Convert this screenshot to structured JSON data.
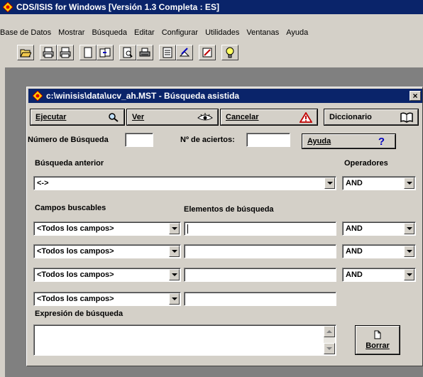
{
  "app": {
    "title": "CDS/ISIS for Windows [Versión 1.3 Completa : ES]"
  },
  "menu": [
    "Base de Datos",
    "Mostrar",
    "Búsqueda",
    "Editar",
    "Configurar",
    "Utilidades",
    "Ventanas",
    "Ayuda"
  ],
  "toolbar": {
    "icons": [
      "open-folder-icon",
      "print-txt-icon",
      "print-rtf-icon",
      "document-icon",
      "copy-doc-icon",
      "preview-icon",
      "printer-icon",
      "form-icon",
      "edit-form-icon",
      "pencil-icon",
      "lightbulb-icon"
    ]
  },
  "dialog": {
    "title": "c:\\winisis\\data\\ucv_ah.MST - Búsqueda asistida",
    "close": "×",
    "buttons": {
      "ejecutar": "Ejecutar",
      "ver": "Ver",
      "cancelar": "Cancelar",
      "diccionario": "Diccionario",
      "ayuda": "Ayuda",
      "ayuda_icon": "?",
      "borrar": "Borrar"
    },
    "labels": {
      "numero_busqueda": "Número de Búsqueda",
      "n_aciertos": "Nº de aciertos:",
      "busqueda_anterior": "Búsqueda anterior",
      "operadores": "Operadores",
      "campos_buscables": "Campos buscables",
      "elementos_busqueda": "Elementos de búsqueda",
      "expresion_busqueda": "Expresión de búsqueda"
    },
    "fields": {
      "numero_busqueda": "",
      "n_aciertos": "",
      "busqueda_anterior": "<->",
      "operador_anterior": "AND"
    },
    "rows": [
      {
        "campo": "<Todos los campos>",
        "elemento": "",
        "operador": "AND"
      },
      {
        "campo": "<Todos los campos>",
        "elemento": "",
        "operador": "AND"
      },
      {
        "campo": "<Todos los campos>",
        "elemento": "",
        "operador": "AND"
      },
      {
        "campo": "<Todos los campos>",
        "elemento": ""
      }
    ],
    "expresion": ""
  },
  "colors": {
    "titlebar": "#0a246a",
    "face": "#d4d0c8",
    "workspace": "#808080"
  }
}
